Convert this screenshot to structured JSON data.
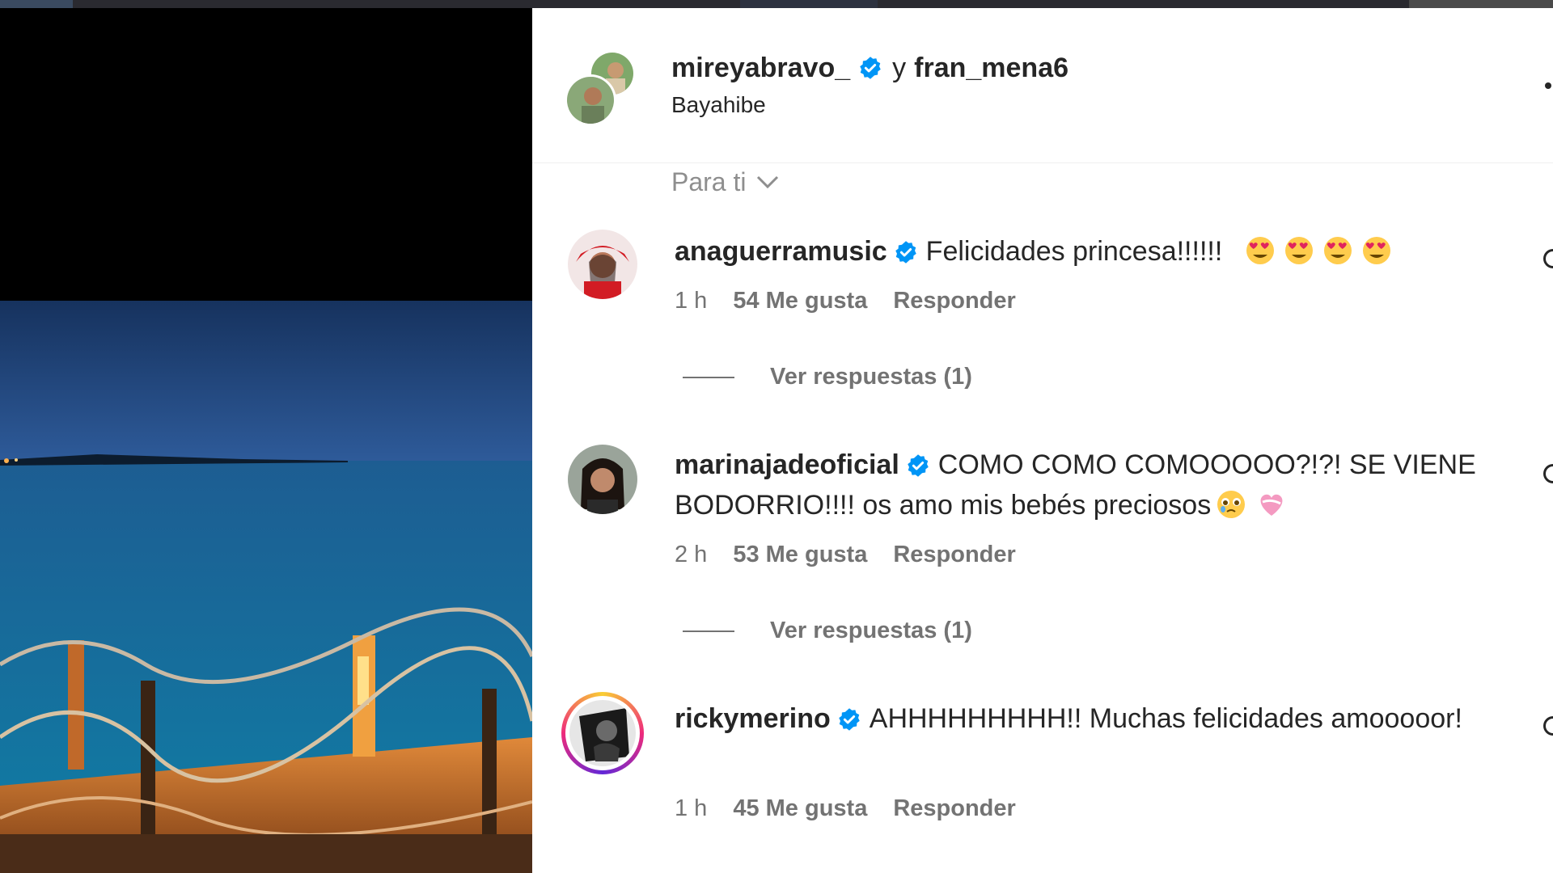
{
  "post": {
    "authors": [
      "mireyabravo_",
      "fran_mena6"
    ],
    "joiner": "y",
    "location": "Bayahibe",
    "sort_label": "Para ti"
  },
  "comments": [
    {
      "username": "anaguerramusic",
      "text": "Felicidades princesa!!!!!!",
      "emojis": [
        "heart-eyes-emoji",
        "heart-eyes-emoji",
        "heart-eyes-emoji",
        "heart-eyes-emoji"
      ],
      "time": "1 h",
      "likes": "54 Me gusta",
      "reply": "Responder",
      "view_replies": "Ver respuestas (1)"
    },
    {
      "username": "marinajadeoficial",
      "text": "COMO COMO COMOOOOO?!?! SE VIENE BODORRIO!!!! os amo mis bebés preciosos",
      "emojis": [
        "pleading-face-emoji",
        "heart-emoji"
      ],
      "time": "2 h",
      "likes": "53 Me gusta",
      "reply": "Responder",
      "view_replies": "Ver respuestas (1)"
    },
    {
      "username": "rickymerino",
      "text": "AHHHHHHHHH!! Muchas felicidades amooooor!",
      "time": "1 h",
      "likes": "45 Me gusta",
      "reply": "Responder"
    }
  ],
  "colors": {
    "verified": "#0095f6",
    "text": "#262626",
    "secondary": "#737373",
    "sort": "#8e8e8e"
  }
}
